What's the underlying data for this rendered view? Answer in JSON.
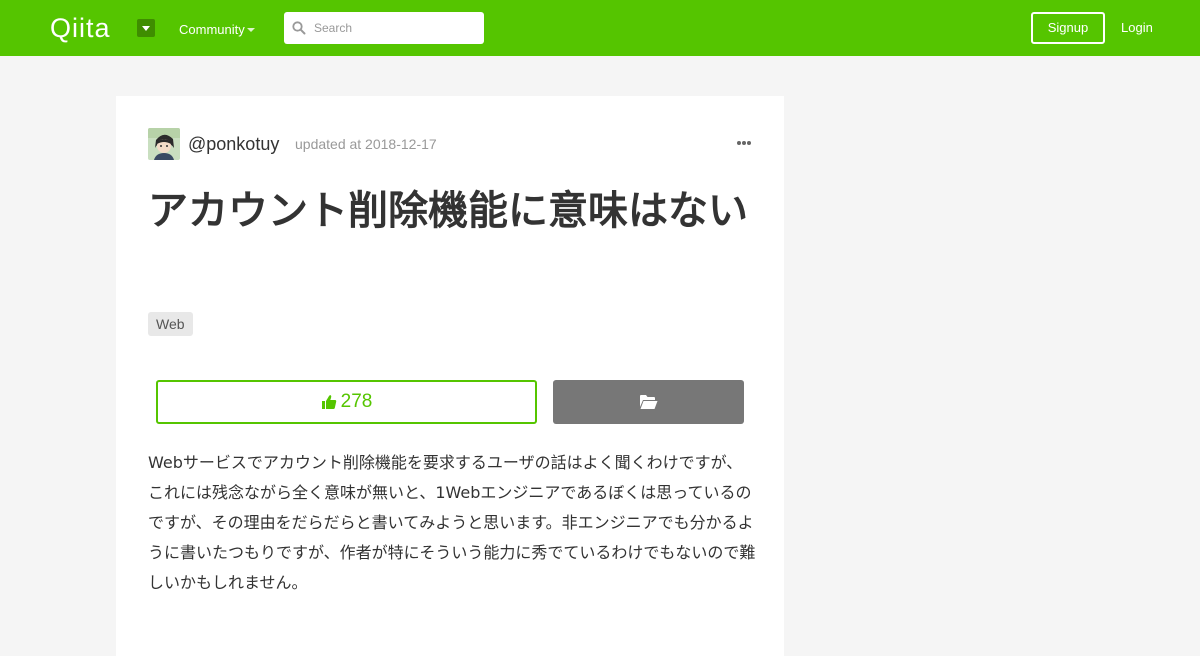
{
  "header": {
    "logo": "Qiita",
    "community_label": "Community",
    "search_placeholder": "Search",
    "signup_label": "Signup",
    "login_label": "Login",
    "brand_color": "#55c500"
  },
  "article": {
    "author": "@ponkotuy",
    "updated": "updated at 2018-12-17",
    "title": "アカウント削除機能に意味はない",
    "tags": [
      "Web"
    ],
    "likes": "278",
    "body": "Webサービスでアカウント削除機能を要求するユーザの話はよく聞くわけですが、これには残念ながら全く意味が無いと、1Webエンジニアであるぼくは思っているのですが、その理由をだらだらと書いてみようと思います。非エンジニアでも分かるように書いたつもりですが、作者が特にそういう能力に秀でているわけでもないので難しいかもしれません。"
  },
  "icons": {
    "search": "search-icon",
    "more": "ellipsis-icon",
    "like": "thumbs-up-icon",
    "stock": "folder-open-icon"
  }
}
